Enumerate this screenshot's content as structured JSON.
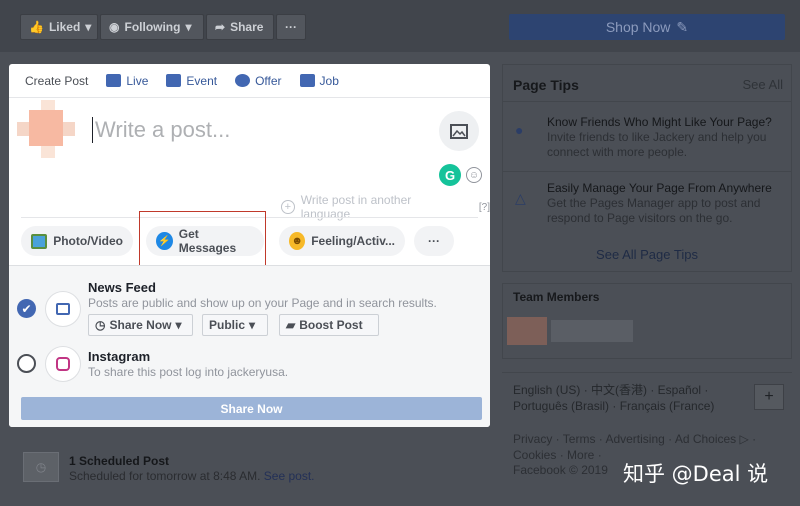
{
  "topbar": {
    "liked_label": "Liked",
    "following_label": "Following",
    "share_label": "Share",
    "more_label": "···",
    "shop_now_label": "Shop Now"
  },
  "composer": {
    "tabs": [
      {
        "label": "Create Post"
      },
      {
        "label": "Live"
      },
      {
        "label": "Event"
      },
      {
        "label": "Offer"
      },
      {
        "label": "Job"
      }
    ],
    "placeholder": "Write a post...",
    "grammarly_label": "G",
    "another_language": "Write post in another language",
    "help_label": "[?]",
    "actions": {
      "photo_video": "Photo/Video",
      "get_messages": "Get Messages",
      "feeling": "Feeling/Activ...",
      "more": "···"
    }
  },
  "distribution": {
    "news_feed_title": "News Feed",
    "news_feed_sub": "Posts are public and show up on your Page and in search results.",
    "share_now": "Share Now",
    "public": "Public",
    "boost_post": "Boost Post",
    "instagram_title": "Instagram",
    "instagram_sub": "To share this post log into jackeryusa.",
    "share_button": "Share Now"
  },
  "scheduled": {
    "title": "1 Scheduled Post",
    "sub": "Scheduled for tomorrow at 8:48 AM.",
    "link": "See post."
  },
  "tips": {
    "title": "Page Tips",
    "see_all": "See All",
    "items": [
      {
        "title": "Know Friends Who Might Like Your Page?",
        "text": "Invite friends to like Jackery and help you connect with more people."
      },
      {
        "title": "Easily Manage Your Page From Anywhere",
        "text": "Get the Pages Manager app to post and respond to Page visitors on the go."
      }
    ],
    "see_all_tips": "See All Page Tips"
  },
  "team": {
    "title": "Team Members"
  },
  "languages": {
    "text": "English (US) · 中文(香港) · Español · Português (Brasil) · Français (France)",
    "add": "+"
  },
  "footer": {
    "links": "Privacy · Terms · Advertising · Ad Choices ▷ · Cookies · More ·",
    "copyright": "Facebook © 2019"
  },
  "watermark": "知乎 @Deal 说"
}
